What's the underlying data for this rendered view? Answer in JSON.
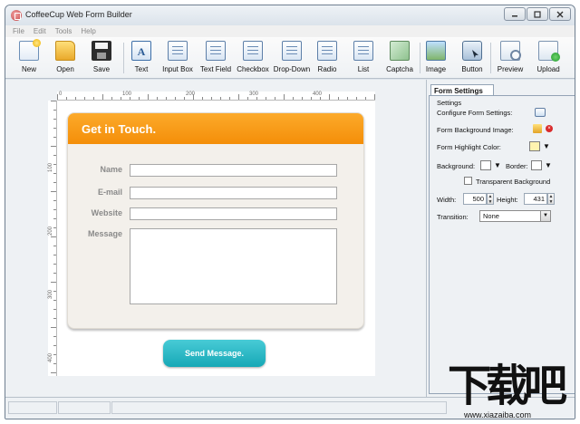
{
  "window": {
    "title": "CoffeeCup Web Form Builder"
  },
  "menu": [
    "File",
    "Edit",
    "Tools",
    "Help"
  ],
  "toolbar": [
    {
      "label": "New",
      "icon": "new-icon"
    },
    {
      "label": "Open",
      "icon": "open-folder-icon"
    },
    {
      "label": "Save",
      "icon": "save-disk-icon"
    },
    {
      "label": "Text",
      "icon": "text-icon"
    },
    {
      "label": "Input Box",
      "icon": "input-box-icon"
    },
    {
      "label": "Text Field",
      "icon": "text-field-icon"
    },
    {
      "label": "Checkbox",
      "icon": "checkbox-icon"
    },
    {
      "label": "Drop-Down",
      "icon": "dropdown-icon"
    },
    {
      "label": "Radio",
      "icon": "radio-icon"
    },
    {
      "label": "List",
      "icon": "list-icon"
    },
    {
      "label": "Captcha",
      "icon": "captcha-icon"
    },
    {
      "label": "Image",
      "icon": "image-icon"
    },
    {
      "label": "Button",
      "icon": "button-icon"
    },
    {
      "label": "Preview",
      "icon": "preview-icon"
    },
    {
      "label": "Upload",
      "icon": "upload-icon"
    }
  ],
  "ruler": {
    "horizontal": [
      "0",
      "100",
      "200",
      "300",
      "400"
    ],
    "vertical": [
      "100",
      "200",
      "300",
      "400"
    ]
  },
  "form": {
    "title": "Get in Touch.",
    "fields": [
      {
        "label": "Name"
      },
      {
        "label": "E-mail"
      },
      {
        "label": "Website"
      },
      {
        "label": "Message"
      }
    ],
    "button": "Send Message.",
    "colors": {
      "header": "#f7960f",
      "button": "#1faebc",
      "card": "#f3f0eb"
    }
  },
  "panel": {
    "tab": "Form Settings",
    "group": "Settings",
    "configure_label": "Configure Form Settings:",
    "bg_image_label": "Form Background Image:",
    "highlight_label": "Form Highlight Color:",
    "highlight_color": "#fff3b0",
    "background_label": "Background:",
    "border_label": "Border:",
    "transparent_label": "Transparent Background",
    "width_label": "Width:",
    "width_value": "500",
    "height_label": "Height:",
    "height_value": "431",
    "transition_label": "Transition:",
    "transition_value": "None"
  },
  "watermark": {
    "text": "下载吧",
    "url": "www.xiazaiba.com"
  }
}
